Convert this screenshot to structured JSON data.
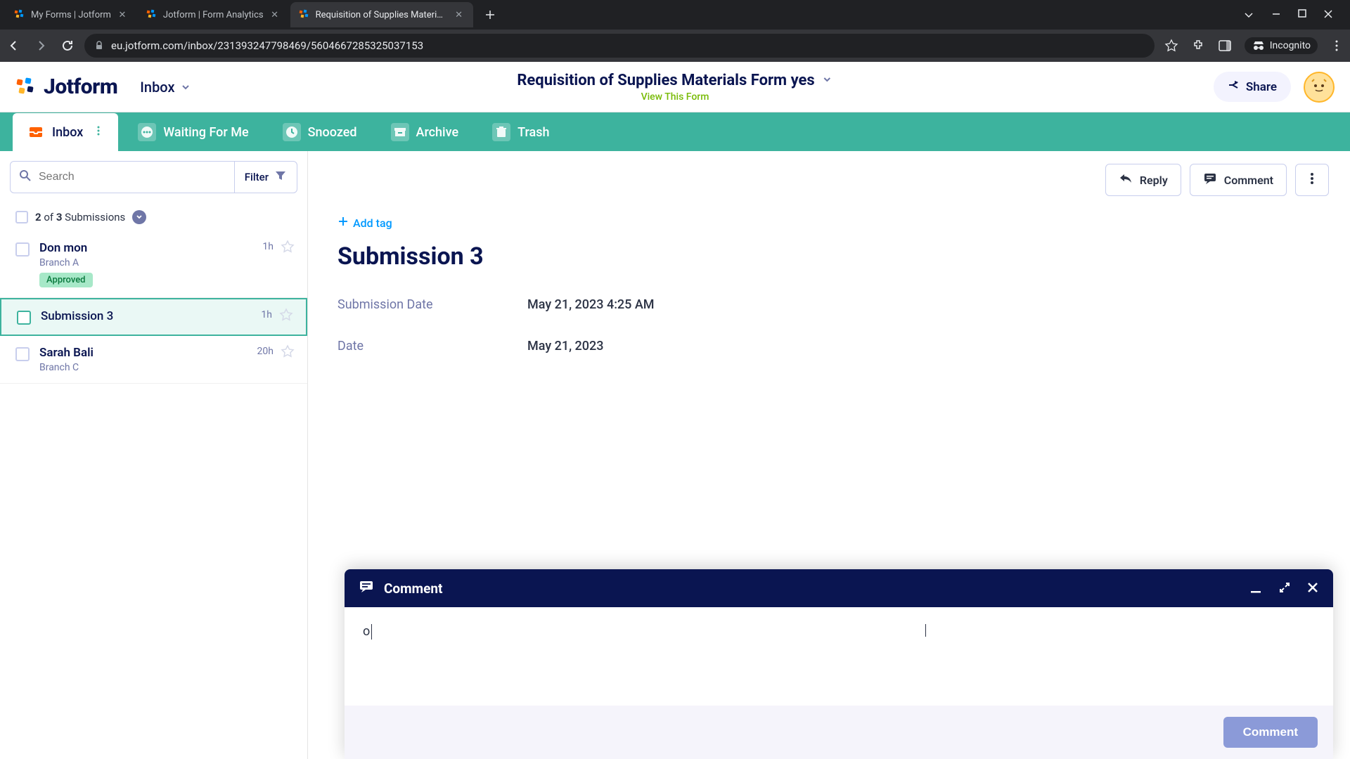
{
  "browser": {
    "tabs": [
      {
        "title": "My Forms | Jotform",
        "active": false
      },
      {
        "title": "Jotform | Form Analytics",
        "active": false
      },
      {
        "title": "Requisition of Supplies Materials",
        "active": true
      }
    ],
    "url": "eu.jotform.com/inbox/231393247798469/5604667285325037153",
    "incognito_label": "Incognito"
  },
  "header": {
    "logo_text": "Jotform",
    "inbox_label": "Inbox",
    "form_title": "Requisition of Supplies Materials Form yes",
    "view_link": "View This Form",
    "share_label": "Share"
  },
  "tabs": {
    "inbox": "Inbox",
    "waiting": "Waiting For Me",
    "snoozed": "Snoozed",
    "archive": "Archive",
    "trash": "Trash"
  },
  "sidebar": {
    "search_placeholder": "Search",
    "filter_label": "Filter",
    "count_bold1": "2",
    "count_mid": " of ",
    "count_bold2": "3",
    "count_tail": " Submissions",
    "items": [
      {
        "name": "Don mon",
        "branch": "Branch A",
        "time": "1h",
        "approved": "Approved",
        "selected": false
      },
      {
        "name": "Submission 3",
        "branch": "",
        "time": "1h",
        "approved": "",
        "selected": true
      },
      {
        "name": "Sarah Bali",
        "branch": "Branch C",
        "time": "20h",
        "approved": "",
        "selected": false
      }
    ]
  },
  "content": {
    "reply_label": "Reply",
    "comment_label": "Comment",
    "add_tag": "Add tag",
    "title": "Submission 3",
    "fields": [
      {
        "label": "Submission Date",
        "value": "May 21, 2023 4:25 AM"
      },
      {
        "label": "Date",
        "value": "May 21, 2023"
      }
    ]
  },
  "comment_panel": {
    "header": "Comment",
    "text": "o",
    "submit": "Comment"
  }
}
